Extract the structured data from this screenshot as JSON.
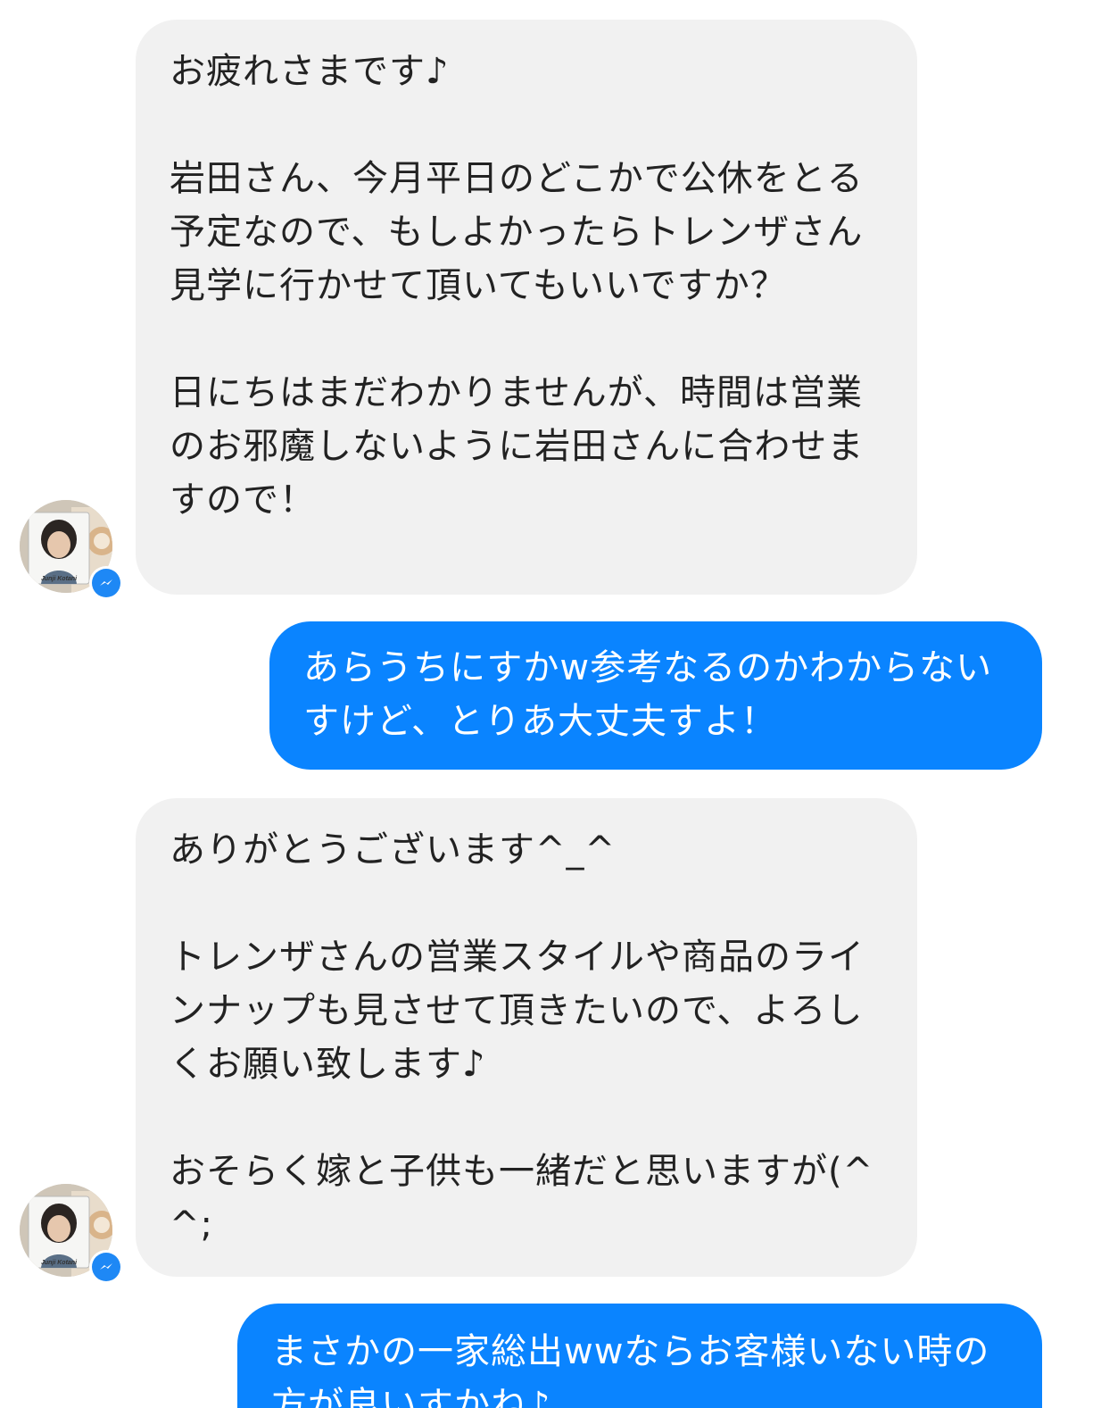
{
  "messages": [
    {
      "direction": "incoming",
      "text": "お疲れさまです♪\n\n岩田さん、今月平日のどこかで公休をとる予定なので、もしよかったらトレンザさん見学に行かせて頂いてもいいですか？\n\n日にちはまだわかりませんが、時間は営業のお邪魔しないように岩田さんに合わせますので！"
    },
    {
      "direction": "outgoing",
      "text": "あらうちにすかw参考なるのかわからないすけど、とりあ大丈夫すよ！"
    },
    {
      "direction": "incoming",
      "text": "ありがとうございます^_^\n\nトレンザさんの営業スタイルや商品のラインナップも見させて頂きたいので、よろしくお願い致します♪\n\nおそらく嫁と子供も一緒だと思いますが(^^;"
    },
    {
      "direction": "outgoing",
      "text": "まさかの一家総出wwならお客様いない時の方が良いすかね♪"
    }
  ],
  "avatar": {
    "caption": "Junji Kotani",
    "badge_icon": "messenger-icon"
  },
  "colors": {
    "incoming_bubble": "#f1f1f1",
    "outgoing_bubble": "#0a84ff",
    "incoming_text": "#222222",
    "outgoing_text": "#ffffff",
    "badge": "#1e88f5"
  }
}
